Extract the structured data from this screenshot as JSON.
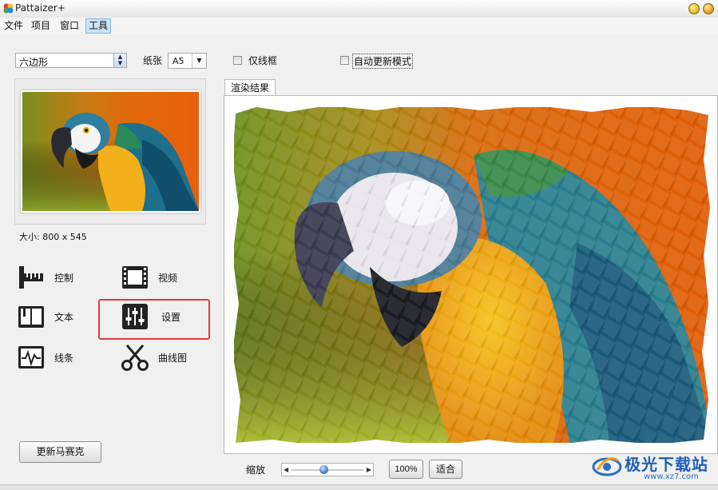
{
  "window": {
    "title": "Pattaizer+"
  },
  "menu": {
    "items": [
      "文件",
      "项目",
      "窗口",
      "工具"
    ],
    "active_index": 3
  },
  "toolbar": {
    "shape_select": "六边形",
    "paper_label": "纸张",
    "paper_value": "A5",
    "wireframe_label": "仅线框",
    "auto_update_label": "自动更新模式"
  },
  "left_panel": {
    "size_label": "大小: 800 x 545",
    "tools": [
      {
        "label": "控制",
        "icon": "ruler-icon"
      },
      {
        "label": "视频",
        "icon": "film-icon"
      },
      {
        "label": "文本",
        "icon": "book-icon"
      },
      {
        "label": "设置",
        "icon": "sliders-icon",
        "highlighted": true
      },
      {
        "label": "线条",
        "icon": "pulse-icon"
      },
      {
        "label": "曲线图",
        "icon": "scissors-icon"
      }
    ],
    "update_button": "更新马赛克"
  },
  "right_panel": {
    "tab_label": "渲染结果",
    "zoom_label": "缩放",
    "zoom_value": "100%",
    "fit_button": "适合",
    "zoom_level": 0.45
  },
  "watermark": {
    "text": "极光下载站",
    "url": "www.xz7.com"
  },
  "colors": {
    "highlight": "#e23a3a",
    "accent": "#1e5fb4"
  }
}
